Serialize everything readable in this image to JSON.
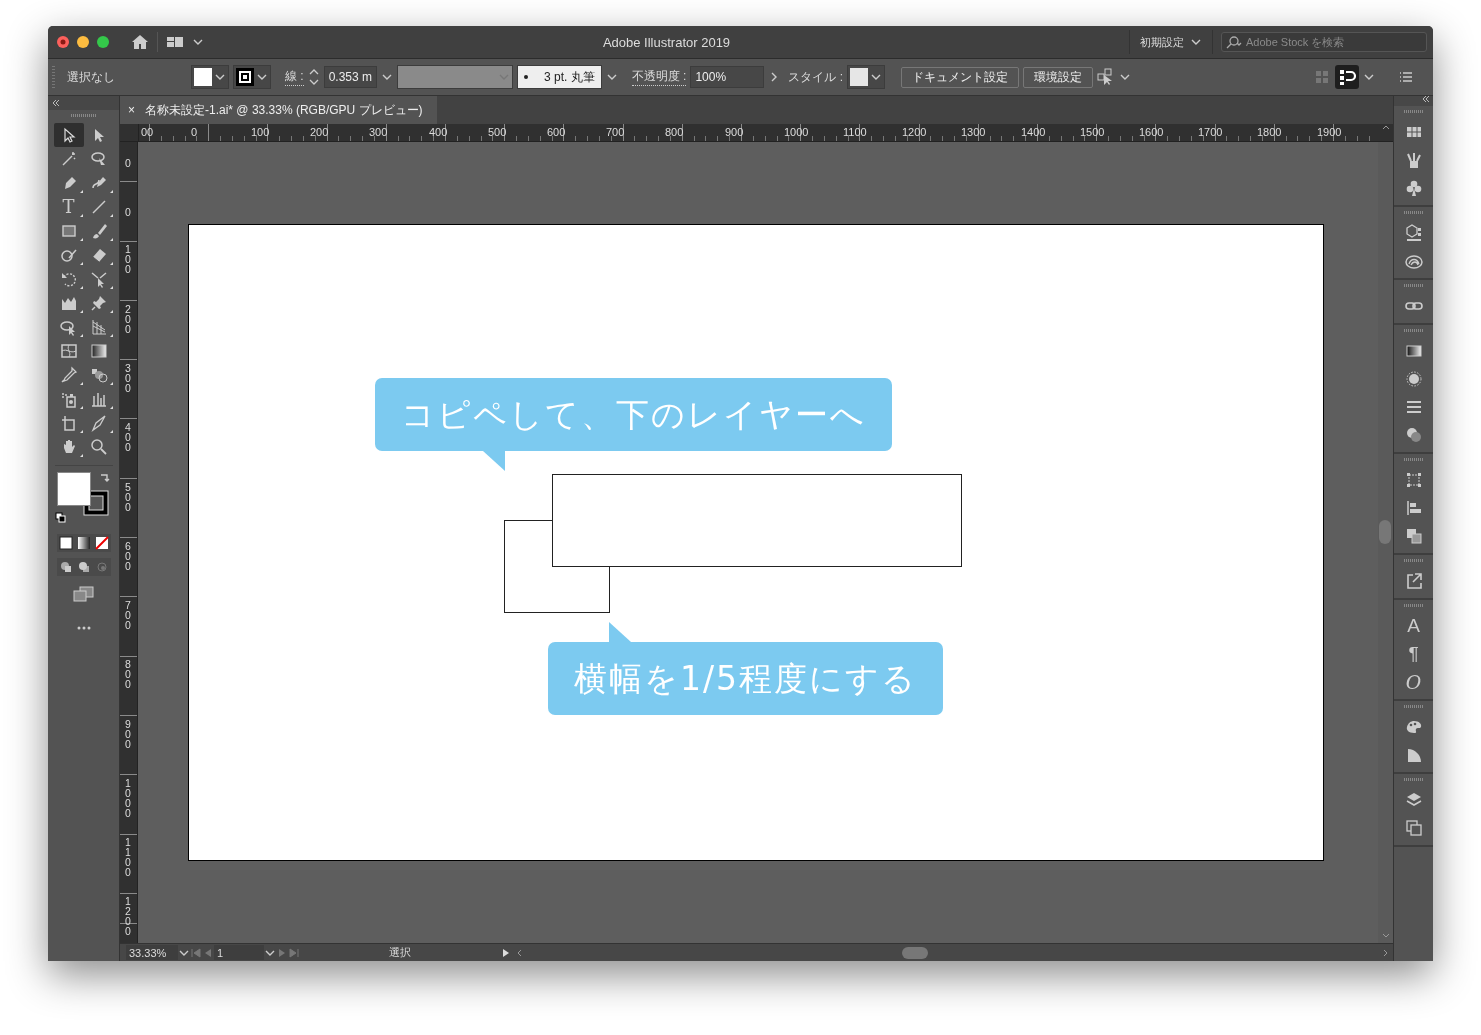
{
  "window": {
    "title": "Adobe Illustrator 2019"
  },
  "workspace": {
    "label": "初期設定"
  },
  "stock_search": {
    "placeholder": "Adobe Stock を検索"
  },
  "control_bar": {
    "selection": "選択なし",
    "stroke_label": "線 :",
    "stroke_weight": "0.353 m",
    "brush": "3 pt. 丸筆",
    "opacity_label": "不透明度 :",
    "opacity": "100%",
    "style_label": "スタイル :",
    "buttons": [
      "ドキュメント設定",
      "環境設定"
    ]
  },
  "document_tab": {
    "close": "×",
    "title": "名称未設定-1.ai* @ 33.33% (RGB/GPU プレビュー)"
  },
  "horizontal_ruler": [
    "00",
    "0",
    "100",
    "200",
    "300",
    "400",
    "500",
    "600",
    "700",
    "800",
    "900",
    "1000",
    "1100",
    "1200",
    "1300",
    "1400",
    "1500",
    "1600",
    "1700",
    "1800",
    "1900"
  ],
  "vertical_ruler": [
    "0",
    "0",
    "100",
    "200",
    "300",
    "400",
    "500",
    "600",
    "700",
    "800",
    "900",
    "1000",
    "1100",
    "1200"
  ],
  "tools": [
    {
      "selected": true
    },
    {
      "selected": false
    },
    {
      "selected": false
    },
    {
      "selected": false
    },
    {
      "selected": false
    },
    {
      "selected": false
    },
    {
      "selected": false,
      "glyph": "T"
    },
    {
      "selected": false
    },
    {
      "selected": false
    },
    {
      "selected": false
    },
    {
      "selected": false
    },
    {
      "selected": false
    },
    {
      "selected": false
    },
    {
      "selected": false
    },
    {
      "selected": false
    },
    {
      "selected": false
    },
    {
      "selected": false
    },
    {
      "selected": false
    },
    {
      "selected": false
    },
    {
      "selected": false
    },
    {
      "selected": false
    },
    {
      "selected": false
    },
    {
      "selected": false
    },
    {
      "selected": false
    },
    {
      "selected": false
    },
    {
      "selected": false
    },
    {
      "selected": false
    },
    {
      "selected": false
    }
  ],
  "callouts": [
    {
      "text": "コピペして、下のレイヤーへ",
      "kind": "tail-down"
    },
    {
      "text": "横幅を1/5程度にする",
      "kind": "tail-up"
    }
  ],
  "panel_glyphs": {
    "character": "A",
    "paragraph": "¶",
    "opentype": "O"
  },
  "status_bar": {
    "zoom": "33.33%",
    "artboard": "1",
    "tool": "選択"
  }
}
